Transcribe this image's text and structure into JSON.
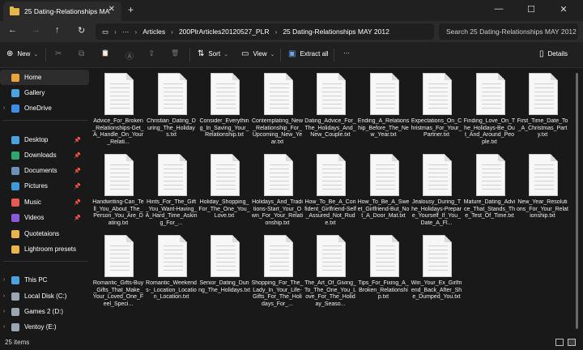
{
  "window": {
    "tab_title": "25 Dating-Relationships MAY 2",
    "tab_close": "✕",
    "new_tab": "+",
    "minimize": "—",
    "maximize": "☐",
    "close": "✕"
  },
  "nav": {
    "back": "←",
    "forward": "→",
    "up": "↑",
    "refresh": "↻",
    "more": "···",
    "sep": "›",
    "breadcrumbs": [
      "Articles",
      "200PlrArticles20120527_PLR",
      "25 Dating-Relationships MAY 2012"
    ],
    "search_placeholder": "Search 25 Dating-Relationships MAY 2012"
  },
  "commands": {
    "new_label": "New",
    "new_icon": "⊕",
    "cut_icon": "✂",
    "copy_icon": "⧉",
    "paste_icon": "📋",
    "rename_icon": "Ⓐ",
    "share_icon": "⇪",
    "delete_icon": "🗑",
    "sort_label": "Sort",
    "sort_icon": "⇅",
    "view_label": "View",
    "view_icon": "▭",
    "extract_label": "Extract all",
    "extract_icon": "▣",
    "more_label": "···",
    "details_label": "Details",
    "details_icon": "▯"
  },
  "sidebar": {
    "chevron": "›",
    "pin": "📌",
    "items": [
      {
        "label": "Home",
        "icon": "home-icon",
        "color": "#e8a33a",
        "active": true,
        "pinned": false
      },
      {
        "label": "Gallery",
        "icon": "gallery-icon",
        "color": "#4aa3df",
        "active": false,
        "pinned": false
      },
      {
        "label": "OneDrive",
        "icon": "cloud-icon",
        "color": "#3a8ee6",
        "active": false,
        "pinned": false
      },
      {
        "label": "Desktop",
        "icon": "desktop-icon",
        "color": "#4aa3df",
        "active": false,
        "pinned": true
      },
      {
        "label": "Downloads",
        "icon": "download-icon",
        "color": "#2fa86b",
        "active": false,
        "pinned": true
      },
      {
        "label": "Documents",
        "icon": "documents-icon",
        "color": "#6d8fb8",
        "active": false,
        "pinned": true
      },
      {
        "label": "Pictures",
        "icon": "pictures-icon",
        "color": "#3f9ad8",
        "active": false,
        "pinned": true
      },
      {
        "label": "Music",
        "icon": "music-icon",
        "color": "#e45a4f",
        "active": false,
        "pinned": true
      },
      {
        "label": "Videos",
        "icon": "videos-icon",
        "color": "#8a5bd6",
        "active": false,
        "pinned": true
      },
      {
        "label": "Quotetaions",
        "icon": "folder-icon",
        "color": "#e8b54a",
        "active": false,
        "pinned": false
      },
      {
        "label": "Lightroom presets",
        "icon": "folder-icon",
        "color": "#e8b54a",
        "active": false,
        "pinned": false
      },
      {
        "label": "This PC",
        "icon": "pc-icon",
        "color": "#4aa3df",
        "active": false,
        "pinned": false
      },
      {
        "label": "Local Disk (C:)",
        "icon": "drive-icon",
        "color": "#9aa7b3",
        "active": false,
        "pinned": false
      },
      {
        "label": "Games 2 (D:)",
        "icon": "drive-icon",
        "color": "#9aa7b3",
        "active": false,
        "pinned": false
      },
      {
        "label": "Ventoy (E:)",
        "icon": "drive-icon",
        "color": "#9aa7b3",
        "active": false,
        "pinned": false
      }
    ]
  },
  "files": [
    "Advice_For_Broken_Relationships-Get_A_Handle_On_Your_Relati...",
    "Christian_Dating_During_The_Holidays.txt",
    "Consider_Everything_In_Saving_Your_Relationship.txt",
    "Contemplating_New_Relationship_For_Upcoming_New_Year.txt",
    "Dating_Advice_For_The_Holidays_And_New_Couple.txt",
    "Ending_A_Relationship_Before_The_New_Year.txt",
    "Expectations_On_Christmas_For_Your_Partner.txt",
    "Finding_Love_On_The_Holidays-Be_Out_And_Around_People.txt",
    "First_Time_Date_To_A_Christmas_Party.txt",
    "Handwriting-Can_Tell_You_About_The_Person_You_Are_Dating.txt",
    "Hints_For_The_Gift_You_Want-Having_A_Hard_Time_Asking_For_...",
    "Holiday_Shopping_For_The_One_You_Love.txt",
    "Holidays_And_Traditions-Start_Your_Own_For_Your_Relationship.txt",
    "How_To_Be_A_Confident_Girlfriend-Self_Assured_Not_Rude.txt",
    "How_To_Be_A_Sweet_Girlfriend-But_Not_A_Door_Mat.txt",
    "Jealousy_During_The_Holidays-Prepare_Yourself_If_You_Date_A_Fl...",
    "Mature_Dating_Advice_That_Stands_The_Test_Of_Time.txt",
    "New_Year_Resolutions_For_Your_Relationship.txt",
    "Romantic_Gifts-Buy_Gifts_That_Make_Your_Loved_One_Feel_Speci...",
    "Romantic_Weekends-_Location_Location_Location.txt",
    "Senior_Dating_During_The_Holidays.txt",
    "Shopping_For_The_Lady_In_Your_Life-Gifts_For_The_Holidays_For_...",
    "The_Art_Of_Giving_To_The_One_You_Love_For_The_Holiday_Seaso...",
    "Tips_For_Fixing_A_Broken_Relationship.txt",
    "Win_Your_Ex_Girlfriend_Back_After_She_Dumped_You.txt"
  ],
  "status": {
    "item_count": "25 items"
  }
}
